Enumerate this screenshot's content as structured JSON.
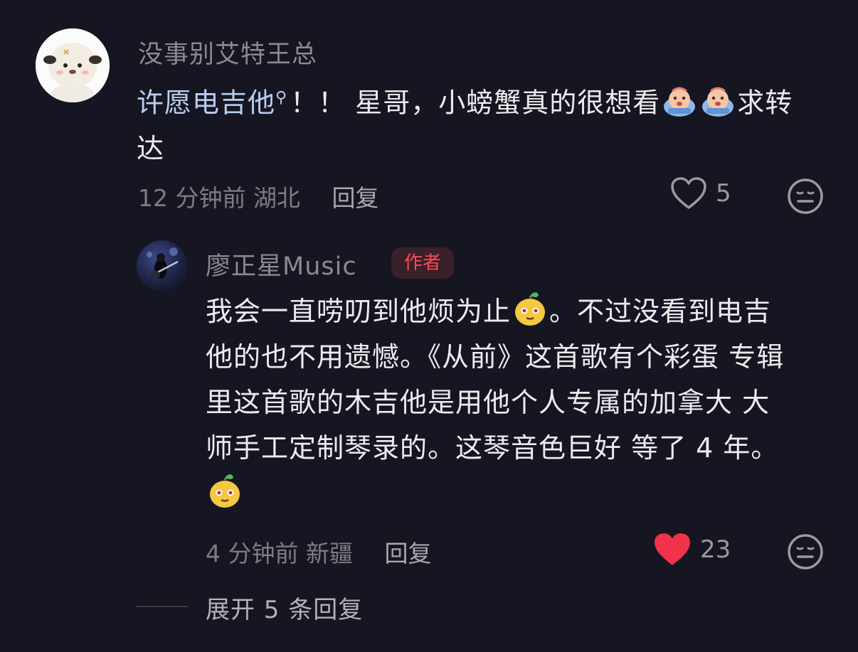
{
  "comment": {
    "username": "没事别艾特王总",
    "link_text": "许愿电吉他",
    "text_part1": "！！ 星哥，小螃蟹真的很想看",
    "text_part2": "求转",
    "text_part3": "达",
    "time": "12 分钟前",
    "location": "湖北",
    "reply_label": "回复",
    "like_count": "5",
    "liked": false
  },
  "reply": {
    "username": "廖正星Music",
    "badge": "作者",
    "text_part1": "我会一直唠叨到他烦为止",
    "text_part2": "。不过没看到电吉",
    "text_part3": "他的也不用遗憾。《从前》这首歌有个彩蛋 专辑",
    "text_part4": "里这首歌的木吉他是用他个人专属的加拿大 大",
    "text_part5": "师手工定制琴录的。这琴音色巨好 等了 4 年。",
    "time": "4 分钟前",
    "location": "新疆",
    "reply_label": "回复",
    "like_count": "23",
    "liked": true
  },
  "expand_replies": "展开 5 条回复",
  "colors": {
    "background": "#161622",
    "link": "#b9cdf0",
    "like_active": "#f0324a",
    "author_badge_text": "#f44a5c",
    "author_badge_bg": "#3a2028"
  },
  "icons": {
    "comment_emoji": "crying-face-emoji",
    "reply_emoji": "smirk-face-emoji",
    "like": "heart-icon",
    "dislike": "meh-face-icon",
    "link_marker": "search-icon"
  }
}
